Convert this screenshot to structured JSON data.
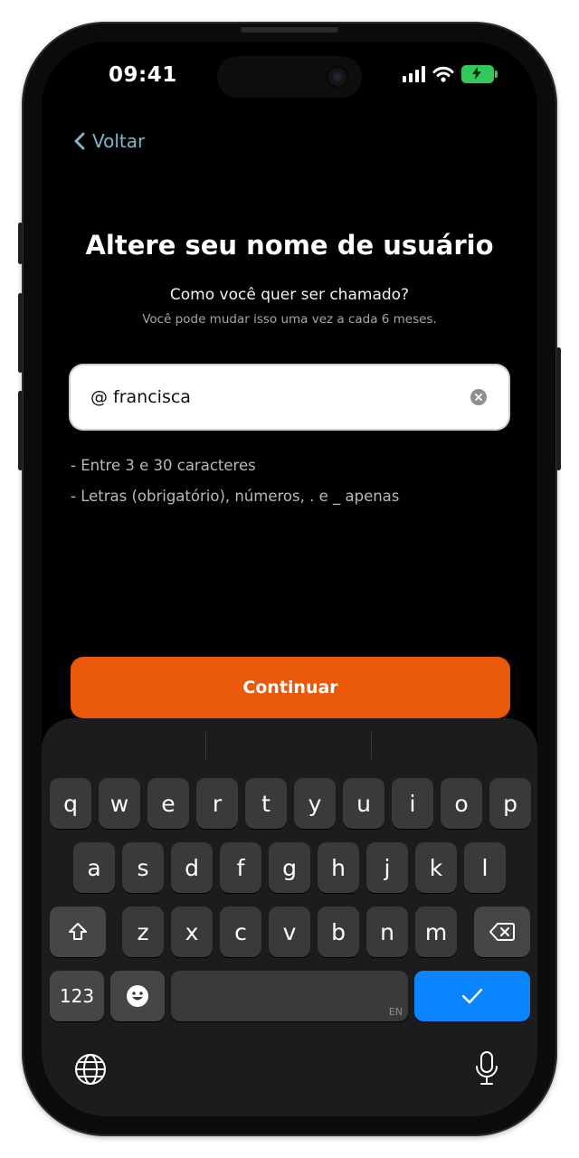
{
  "status_bar": {
    "time": "09:41"
  },
  "nav": {
    "back_label": "Voltar"
  },
  "header": {
    "title": "Altere seu nome de usuário",
    "subtitle": "Como você quer ser chamado?",
    "hint": "Você pode mudar isso uma vez a cada 6 meses."
  },
  "username_field": {
    "value": "@ francisca"
  },
  "rules": [
    "- Entre 3 e 30 caracteres",
    "- Letras (obrigatório), números, . e _ apenas"
  ],
  "continue_label": "Continuar",
  "keyboard": {
    "row1": [
      "q",
      "w",
      "e",
      "r",
      "t",
      "y",
      "u",
      "i",
      "o",
      "p"
    ],
    "row2": [
      "a",
      "s",
      "d",
      "f",
      "g",
      "h",
      "j",
      "k",
      "l"
    ],
    "row3": [
      "z",
      "x",
      "c",
      "v",
      "b",
      "n",
      "m"
    ],
    "numbers_label": "123",
    "language_badge": "EN"
  },
  "colors": {
    "accent": "#ea580c",
    "link": "#7fb7c6",
    "done_key": "#0a84ff",
    "battery": "#34c759"
  },
  "icons": [
    "back-chevron-icon",
    "signal-icon",
    "wifi-icon",
    "battery-charging-icon",
    "clear-icon",
    "shift-icon",
    "backspace-icon",
    "emoji-icon",
    "checkmark-icon",
    "globe-icon",
    "microphone-icon"
  ]
}
